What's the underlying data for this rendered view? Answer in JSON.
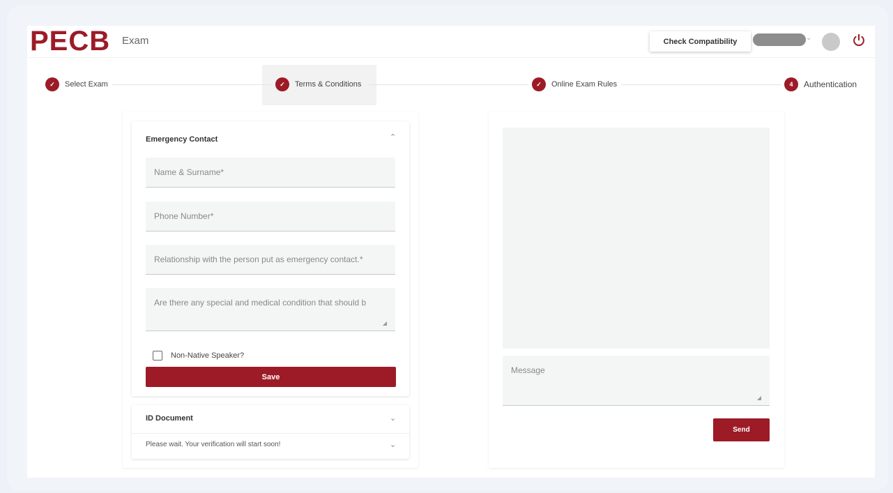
{
  "header": {
    "logo": "PECB",
    "logo_sub": "Exam",
    "check_compatibility": "Check Compatibility"
  },
  "stepper": {
    "steps": [
      {
        "label": "Select Exam",
        "status": "done"
      },
      {
        "label": "Terms & Conditions",
        "status": "done"
      },
      {
        "label": "Online Exam Rules",
        "status": "done"
      },
      {
        "label": "Authentication",
        "number": "4",
        "status": "current"
      }
    ]
  },
  "emergency": {
    "title": "Emergency Contact",
    "name_placeholder": "Name & Surname*",
    "phone_placeholder": "Phone Number*",
    "relationship_placeholder": "Relationship with the person put as emergency contact.*",
    "medical_placeholder": "Are there any special and medical condition that should b",
    "non_native_label": "Non-Native Speaker?",
    "save_label": "Save"
  },
  "id_document": {
    "title": "ID Document",
    "status_text": "Please wait. Your verification will start soon!"
  },
  "chat": {
    "message_placeholder": "Message",
    "send_label": "Send"
  },
  "colors": {
    "brand": "#9c1b27"
  }
}
